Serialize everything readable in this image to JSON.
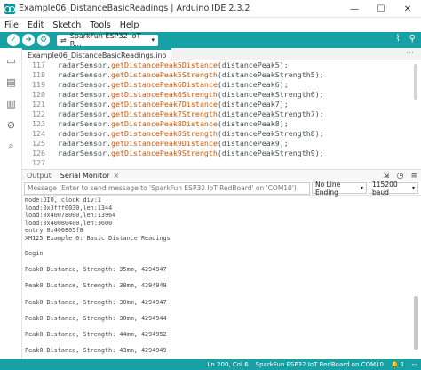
{
  "window": {
    "title": "Example06_DistanceBasicReadings | Arduino IDE 2.3.2",
    "controls": [
      "—",
      "☐",
      "✕"
    ]
  },
  "menu": [
    "File",
    "Edit",
    "Sketch",
    "Tools",
    "Help"
  ],
  "toolbar": {
    "verify_icon": "check-icon",
    "upload_icon": "arrow-right-icon",
    "debug_icon": "debug-icon",
    "board": "SparkFun ESP32 IoT R...",
    "board_chevron": "▾",
    "right_icons": [
      "plotter-icon",
      "serial-monitor-icon"
    ]
  },
  "editor": {
    "tab": "Example06_DistanceBasicReadings.ino",
    "tab_more": "···",
    "lines": [
      {
        "n": "117",
        "obj": "radarSensor.",
        "fn": "getDistancePeak5Distance",
        "arg": "(distancePeak5);"
      },
      {
        "n": "118",
        "obj": "radarSensor.",
        "fn": "getDistancePeak5Strength",
        "arg": "(distancePeakStrength5);"
      },
      {
        "n": "119",
        "obj": "radarSensor.",
        "fn": "getDistancePeak6Distance",
        "arg": "(distancePeak6);"
      },
      {
        "n": "120",
        "obj": "radarSensor.",
        "fn": "getDistancePeak6Strength",
        "arg": "(distancePeakStrength6);"
      },
      {
        "n": "121",
        "obj": "radarSensor.",
        "fn": "getDistancePeak7Distance",
        "arg": "(distancePeak7);"
      },
      {
        "n": "122",
        "obj": "radarSensor.",
        "fn": "getDistancePeak7Strength",
        "arg": "(distancePeakStrength7);"
      },
      {
        "n": "123",
        "obj": "radarSensor.",
        "fn": "getDistancePeak8Distance",
        "arg": "(distancePeak8);"
      },
      {
        "n": "124",
        "obj": "radarSensor.",
        "fn": "getDistancePeak8Strength",
        "arg": "(distancePeakStrength8);"
      },
      {
        "n": "125",
        "obj": "radarSensor.",
        "fn": "getDistancePeak9Distance",
        "arg": "(distancePeak9);"
      },
      {
        "n": "126",
        "obj": "radarSensor.",
        "fn": "getDistancePeak9Strength",
        "arg": "(distancePeakStrength9);"
      },
      {
        "n": "127",
        "obj": "",
        "fn": "",
        "arg": ""
      }
    ]
  },
  "panel": {
    "tabs": [
      "Output",
      "Serial Monitor"
    ],
    "close": "×",
    "message_placeholder": "Message (Enter to send message to 'SparkFun ESP32 IoT RedBoard' on 'COM10')",
    "line_ending": "No Line Ending",
    "baud": "115200 baud",
    "chevron": "▾",
    "output": [
      "mode:DIO, clock div:1",
      "load:0x3fff0030,len:1344",
      "load:0x40078000,len:13964",
      "load:0x40080400,len:3600",
      "entry 0x400805f0",
      "XM125 Example 6: Basic Distance Readings",
      "",
      "Begin",
      "",
      "Peak0 Distance, Strength: 35mm, 4294947",
      "",
      "Peak0 Distance, Strength: 30mm, 4294949",
      "",
      "Peak0 Distance, Strength: 30mm, 4294947",
      "",
      "Peak0 Distance, Strength: 30mm, 4294944",
      "",
      "Peak0 Distance, Strength: 44mm, 4294952",
      "",
      "Peak0 Distance, Strength: 43mm, 4294949"
    ]
  },
  "status": {
    "position": "Ln 200, Col 6",
    "board": "SparkFun ESP32 IoT RedBoard on COM10",
    "notifications": "🔔 1",
    "panel_toggle": "▭"
  },
  "colors": {
    "accent": "#17a1a5",
    "function": "#d35400"
  }
}
